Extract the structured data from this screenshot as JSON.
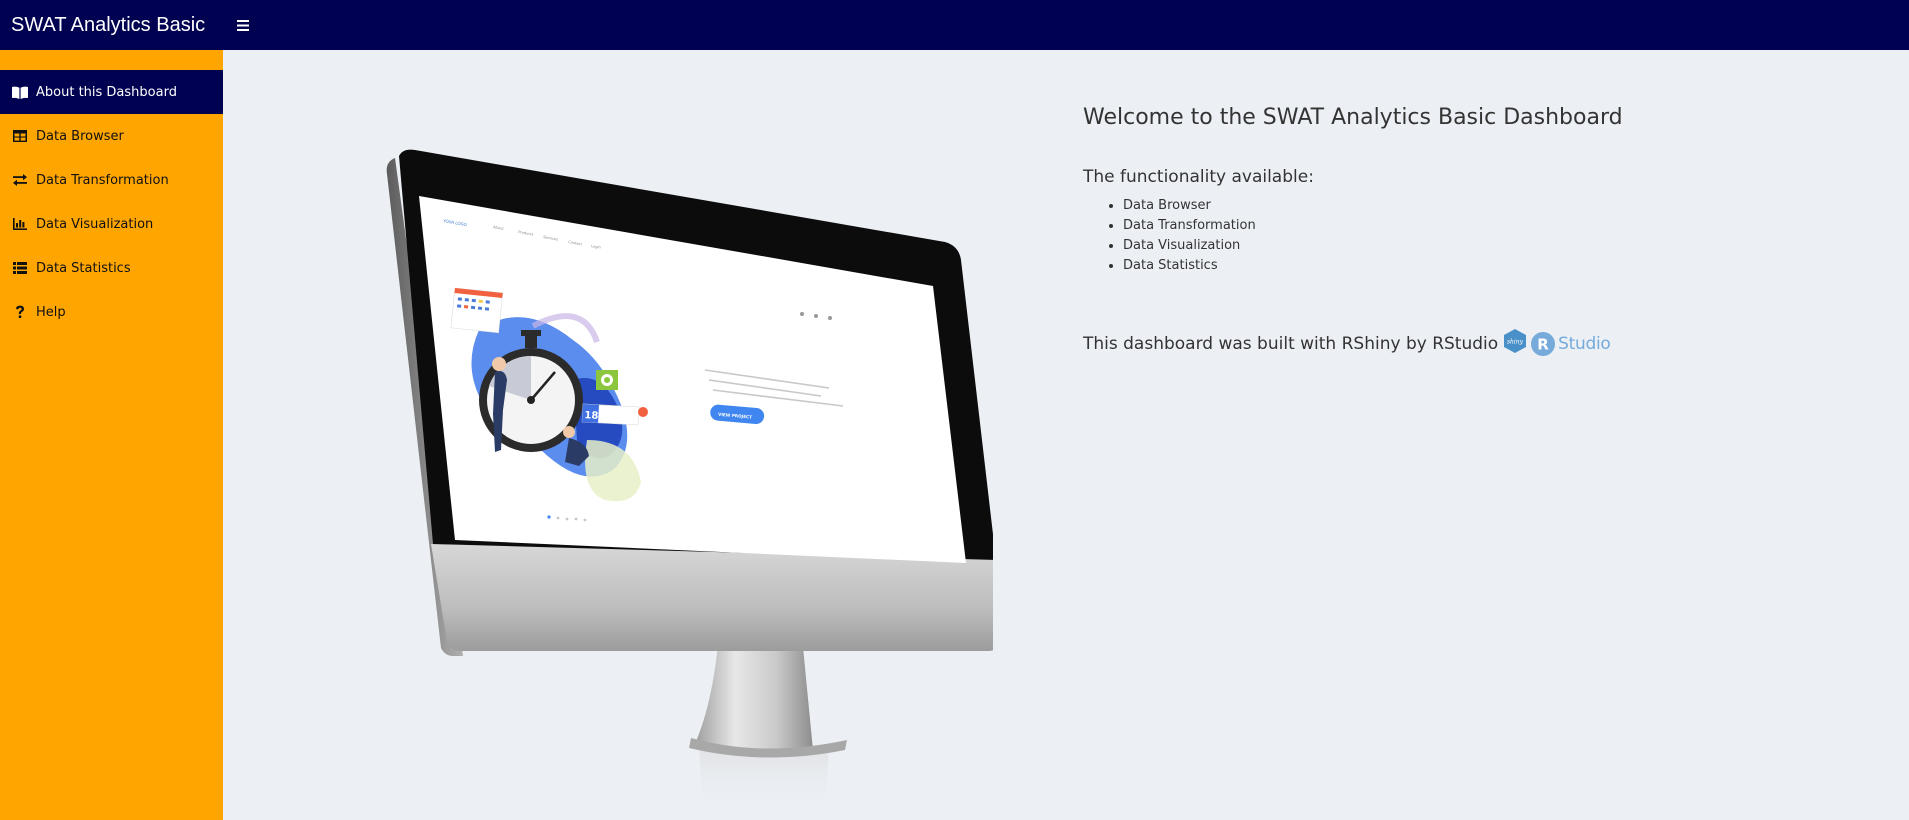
{
  "header": {
    "title": "SWAT Analytics Basic",
    "toggle_icon": "hamburger-icon",
    "bg_color": "#010152"
  },
  "sidebar": {
    "bg_color": "#ffa500",
    "active_color": "#010152",
    "items": [
      {
        "label": "About this Dashboard",
        "icon": "book-open-icon",
        "active": true
      },
      {
        "label": "Data Browser",
        "icon": "table-icon",
        "active": false
      },
      {
        "label": "Data Transformation",
        "icon": "exchange-icon",
        "active": false
      },
      {
        "label": "Data Visualization",
        "icon": "bar-chart-icon",
        "active": false
      },
      {
        "label": "Data Statistics",
        "icon": "list-icon",
        "active": false
      },
      {
        "label": "Help",
        "icon": "question-icon",
        "active": false
      }
    ]
  },
  "main": {
    "heading": "Welcome to the SWAT Analytics Basic Dashboard",
    "functionality_title": "The functionality available:",
    "functionality": [
      "Data Browser",
      "Data Transformation",
      "Data Visualization",
      "Data Statistics"
    ],
    "built_with": "This dashboard was built with RShiny by RStudio",
    "logos": {
      "shiny": "shiny",
      "rstudio_letter": "R",
      "rstudio_word": "Studio"
    },
    "illustration": {
      "screen_logo": "YOUR LOGO",
      "screen_nav": [
        "About",
        "Products",
        "Services",
        "Contact",
        "Login"
      ],
      "screen_number": "18",
      "screen_button": "VIEW PROJECT"
    }
  }
}
